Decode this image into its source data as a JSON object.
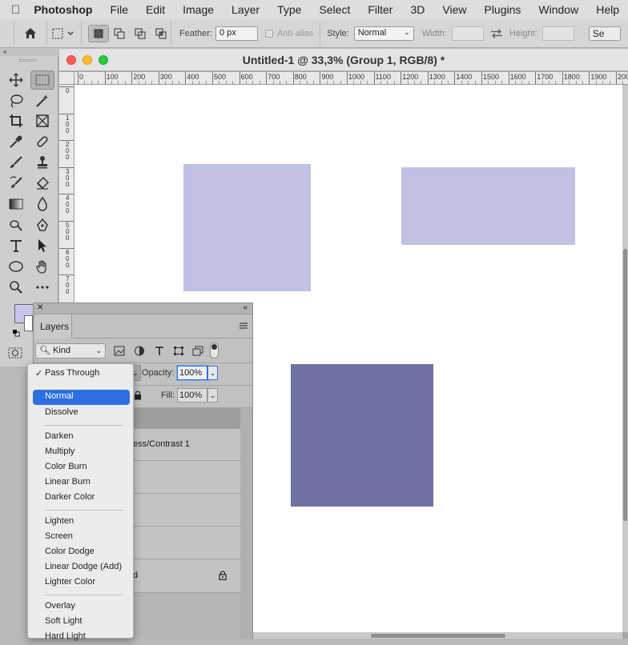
{
  "menubar": {
    "app_name": "Photoshop",
    "items": [
      "File",
      "Edit",
      "Image",
      "Layer",
      "Type",
      "Select",
      "Filter",
      "3D",
      "View",
      "Plugins",
      "Window",
      "Help"
    ]
  },
  "options_bar": {
    "feather_label": "Feather:",
    "feather_value": "0 px",
    "antialias_label": "Anti-alias",
    "style_label": "Style:",
    "style_value": "Normal",
    "width_label": "Width:",
    "height_label": "Height:",
    "select_mask_label": "Se"
  },
  "document": {
    "title": "Untitled-1 @ 33,3% (Group 1, RGB/8) *",
    "h_ruler_ticks": [
      "0",
      "100",
      "200",
      "300",
      "400",
      "500",
      "600",
      "700",
      "800",
      "900",
      "1000",
      "1100",
      "1200",
      "1300",
      "1400",
      "1500",
      "1600",
      "1700",
      "1800",
      "1900",
      "200"
    ],
    "v_ruler_ticks": [
      "0",
      "100",
      "200",
      "300",
      "400",
      "500",
      "600",
      "700"
    ]
  },
  "canvas_shapes": [
    {
      "name": "light-rectangle-1",
      "color": "#c0c1e4"
    },
    {
      "name": "light-rectangle-2",
      "color": "#c0c1e4"
    },
    {
      "name": "dark-rectangle",
      "color": "#6f71a2"
    }
  ],
  "colors": {
    "foreground": "#c5c6ea",
    "background": "#ffffff",
    "highlight": "#2d6fe0"
  },
  "layers_panel": {
    "tab_label": "Layers",
    "filter_kind": "Kind",
    "opacity_label": "Opacity:",
    "opacity_value": "100%",
    "fill_label": "Fill:",
    "fill_value": "100%",
    "layer_fragments": [
      "ess/Contrast 1",
      "d"
    ]
  },
  "blend_menu": {
    "checked_label": "Pass Through",
    "highlighted": "Normal",
    "items": [
      "Pass Through",
      "Normal",
      "Dissolve",
      "Darken",
      "Multiply",
      "Color Burn",
      "Linear Burn",
      "Darker Color",
      "Lighten",
      "Screen",
      "Color Dodge",
      "Linear Dodge (Add)",
      "Lighter Color",
      "Overlay",
      "Soft Light",
      "Hard Light"
    ]
  }
}
